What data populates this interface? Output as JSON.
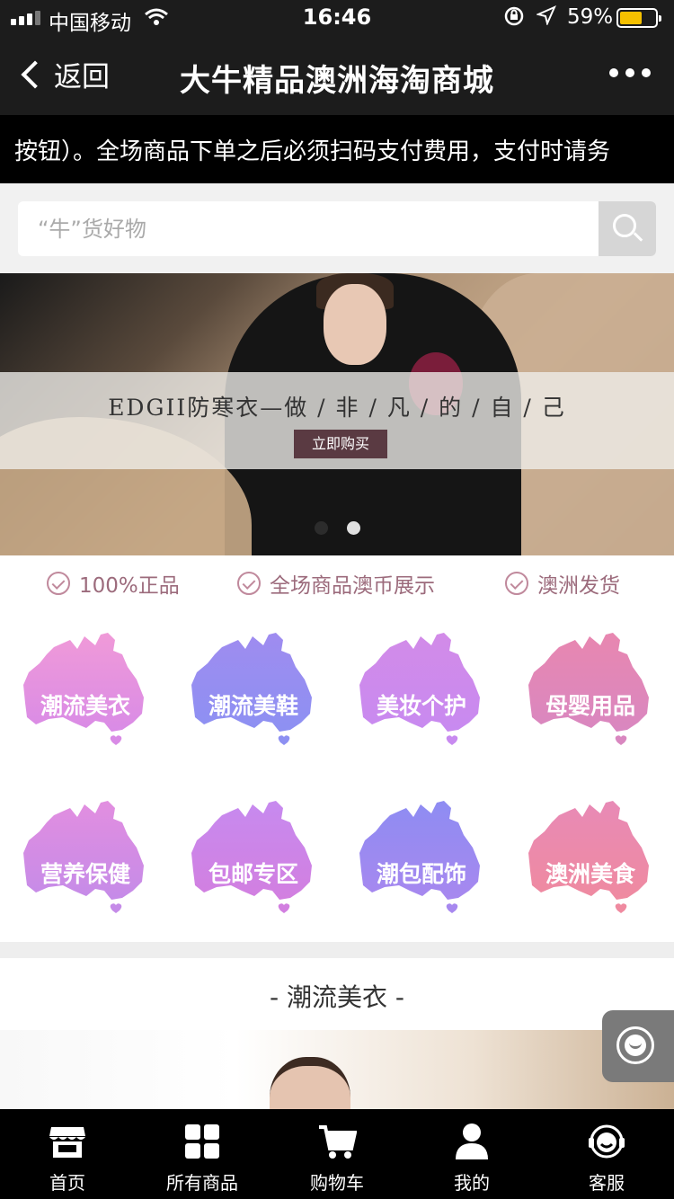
{
  "status_bar": {
    "carrier": "中国移动",
    "time": "16:46",
    "battery": "59%",
    "battery_level": 0.59
  },
  "nav": {
    "back_label": "返回",
    "title": "大牛精品澳洲海淘商城"
  },
  "marquee": {
    "text": "按钮）。全场商品下单之后必须扫码支付费用，支付时请务"
  },
  "search": {
    "placeholder": "“牛”货好物"
  },
  "banner": {
    "headline": "EDGII防寒衣—做 / 非 / 凡 / 的 / 自 / 己",
    "button": "立即购买",
    "active_slide": 2,
    "slides": 2
  },
  "guarantees": [
    "100%正品",
    "全场商品澳币展示",
    "澳洲发货"
  ],
  "categories": [
    {
      "label": "潮流美衣",
      "color_top": "#f09ad8",
      "color_bottom": "#d98be6"
    },
    {
      "label": "潮流美鞋",
      "color_top": "#9f8cf0",
      "color_bottom": "#8d90f2"
    },
    {
      "label": "美妆个护",
      "color_top": "#d28be8",
      "color_bottom": "#c88af0"
    },
    {
      "label": "母婴用品",
      "color_top": "#e887b0",
      "color_bottom": "#d987c0"
    },
    {
      "label": "营养保健",
      "color_top": "#e28ee0",
      "color_bottom": "#c58be8"
    },
    {
      "label": "包邮专区",
      "color_top": "#c78aef",
      "color_bottom": "#d27fe0"
    },
    {
      "label": "潮包配饰",
      "color_top": "#8e8cf2",
      "color_bottom": "#a788ef"
    },
    {
      "label": "澳洲美食",
      "color_top": "#e88ab6",
      "color_bottom": "#ef8aa0"
    }
  ],
  "section": {
    "title": "- 潮流美衣 -"
  },
  "tabbar": [
    {
      "label": "首页",
      "icon": "store-icon"
    },
    {
      "label": "所有商品",
      "icon": "grid-icon"
    },
    {
      "label": "购物车",
      "icon": "cart-icon"
    },
    {
      "label": "我的",
      "icon": "user-icon"
    },
    {
      "label": "客服",
      "icon": "service-icon"
    }
  ]
}
